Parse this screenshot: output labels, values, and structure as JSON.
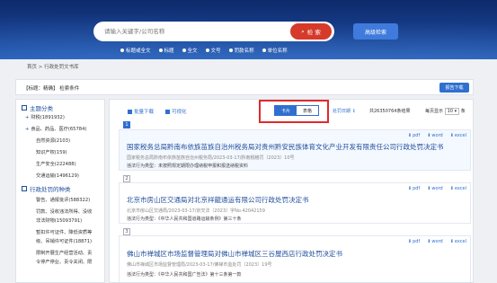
{
  "search": {
    "placeholder": "请输入关键字/公司名称",
    "button_label": "检 索",
    "advanced_label": "高级检索",
    "scopes": [
      "标题或全文",
      "标题",
      "全文",
      "文号",
      "罚款名称",
      "单位名称"
    ]
  },
  "breadcrumb": "首页 > 行政处罚文书库",
  "condition": {
    "label": "【标题：精确】 检索条件",
    "report_button": "报告下载"
  },
  "sidebar": {
    "title": "主题分类",
    "items": [
      {
        "prefix": "+",
        "label": "财税(1891932)",
        "indent": 1
      },
      {
        "prefix": "+",
        "label": "食品、药品、医疗(65784)",
        "indent": 1
      },
      {
        "prefix": "",
        "label": "自然资源(2103)",
        "indent": 2
      },
      {
        "prefix": "",
        "label": "知识产权(159)",
        "indent": 2
      },
      {
        "prefix": "",
        "label": "生产安全(222488)",
        "indent": 2
      },
      {
        "prefix": "",
        "label": "交通运输(1496129)",
        "indent": 2
      }
    ],
    "section2_title": "行政处罚的种类",
    "section2_items": [
      "警告、通报批评(588322)",
      "罚款、没收违法所得、没收",
      "非法财物(15093791)",
      "暂扣许可证件、降低资质等",
      "级、吊销许可证件(18871)",
      "限制开展生产经营活动、责",
      "令停产停业、责令关闭、限"
    ]
  },
  "toolbar": {
    "batch_download": "批量下载",
    "visualize": "可视化",
    "view_card": "卡片",
    "view_table": "表格",
    "sort_label": "处罚日期",
    "sort_arrow": "↕",
    "total": "共26350764条结果",
    "per_page_label": "每页显示",
    "per_page_value": "10",
    "per_page_unit": "条"
  },
  "results": [
    {
      "index": "1",
      "title": "国家税务总局黔南布依族苗族自治州税务局对贵州黔安民族体育文化产业开发有限责任公司行政处罚决定书",
      "meta": "国家税务总局黔南布依族苗族自治州税务局/2023-03-17/黔南税稽罚〔2023〕10号",
      "desc": "违法行为类型：未按照规定期限办理纳税申报和报送纳税资料",
      "downloads": [
        "word",
        "pdf",
        "excel"
      ]
    },
    {
      "index": "2",
      "title": "北京市房山区交通局对北京祥龍通运有限公司行政处罚决定书",
      "meta": "北京市房山区交通局/2023-03-17/京交法〔2023〕字No.42042159",
      "desc": "违法行为类型：《中华人民共和国道路运输条例》第三十条",
      "downloads": [
        "word",
        "pdf",
        "excel"
      ]
    },
    {
      "index": "3",
      "title": "佛山市禅城区市场监督管理局对佛山市禅城区三谷屋西店行政处罚决定书",
      "meta": "佛山市禅城区市场监督管理局/2023-03-17/佛禅市监处罚〔2023〕19号",
      "desc": "违法行为类型：《中华人民共和国广告法》第十三条第一款",
      "downloads": [
        "word",
        "pdf",
        "excel"
      ]
    }
  ]
}
